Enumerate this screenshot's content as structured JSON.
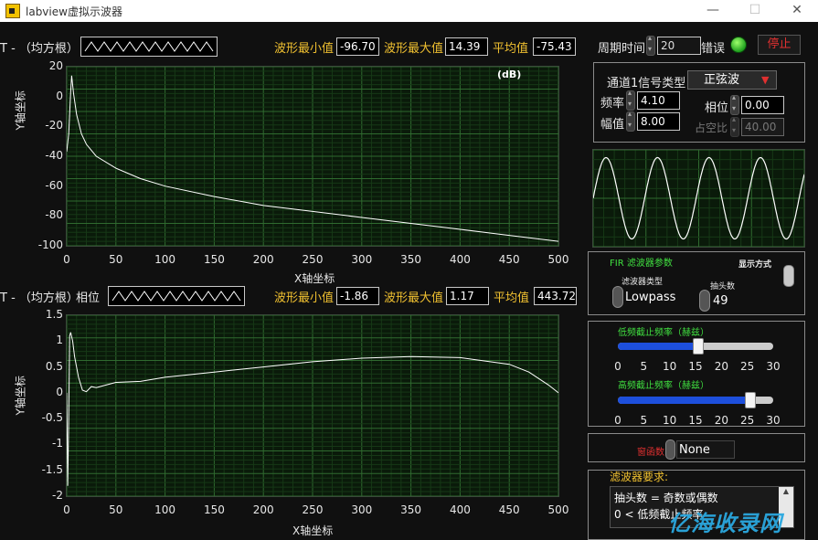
{
  "window": {
    "title": "labview虚拟示波器"
  },
  "graph1": {
    "header_prefix": "T - （均方根）",
    "min_label": "波形最小值",
    "min_value": "-96.70",
    "max_label": "波形最大值",
    "max_value": "14.39",
    "avg_label": "平均值",
    "avg_value": "-75.43",
    "unit_tag": "(dB)",
    "y_label": "Y轴坐标",
    "x_label": "X轴坐标",
    "y_ticks": [
      "20",
      "0",
      "-20",
      "-40",
      "-60",
      "-80",
      "-100"
    ],
    "x_ticks": [
      "0",
      "50",
      "100",
      "150",
      "200",
      "250",
      "300",
      "350",
      "400",
      "450",
      "500"
    ]
  },
  "graph2": {
    "header_prefix": "T - （均方根）",
    "phase_label": "相位",
    "min_label": "波形最小值",
    "min_value": "-1.86",
    "max_label": "波形最大值",
    "max_value": "1.17",
    "avg_label": "平均值",
    "avg_value": "443.72n",
    "y_label": "Y轴坐标",
    "x_label": "X轴坐标",
    "y_ticks": [
      "1.5",
      "1",
      "0.5",
      "0",
      "-0.5",
      "-1",
      "-1.5",
      "-2"
    ],
    "x_ticks": [
      "0",
      "50",
      "100",
      "150",
      "200",
      "250",
      "300",
      "350",
      "400",
      "450",
      "500"
    ]
  },
  "controls": {
    "period_label": "周期时间",
    "period_value": "20",
    "error_label": "错误",
    "stop_label": "停止",
    "signal_type_label": "通道1信号类型",
    "signal_type_value": "正弦波",
    "freq_label": "频率",
    "freq_value": "4.10",
    "amp_label": "幅值",
    "amp_value": "8.00",
    "phase_label": "相位",
    "phase_value": "0.00",
    "duty_label": "占空比",
    "duty_value": "40.00"
  },
  "fir": {
    "title": "FIR 滤波器参数",
    "type_label": "滤波器类型",
    "type_value": "Lowpass",
    "taps_label": "抽头数",
    "taps_value": "49",
    "display_label": "显示方式"
  },
  "sliders": {
    "low_label": "低频截止频率（赫兹）",
    "low_value": 15.5,
    "high_label": "高频截止频率（赫兹）",
    "high_value": 25.5,
    "ticks": [
      "0",
      "5",
      "10",
      "15",
      "20",
      "25",
      "30"
    ],
    "max": 30
  },
  "window_fn": {
    "label": "窗函数",
    "value": "None"
  },
  "requirements": {
    "title": "滤波器要求:",
    "line1": "抽头数 = 奇数或偶数",
    "line2": "0 < 低频截止频率"
  },
  "watermark": "亿海收录网",
  "chart_data": [
    {
      "type": "line",
      "title": "(dB)",
      "xlabel": "X轴坐标",
      "ylabel": "Y轴坐标",
      "xlim": [
        0,
        500
      ],
      "ylim": [
        -100,
        20
      ],
      "grid": true,
      "x": [
        0,
        2,
        4,
        5,
        7,
        10,
        15,
        20,
        30,
        50,
        75,
        100,
        150,
        200,
        250,
        300,
        350,
        400,
        450,
        500
      ],
      "y": [
        -37,
        -25,
        3,
        14,
        2,
        -12,
        -25,
        -32,
        -40,
        -48,
        -55,
        -60,
        -67,
        -73,
        -77,
        -81,
        -85,
        -89,
        -93,
        -97
      ]
    },
    {
      "type": "line",
      "xlabel": "X轴坐标",
      "ylabel": "Y轴坐标",
      "xlim": [
        0,
        500
      ],
      "ylim": [
        -2,
        1.5
      ],
      "grid": true,
      "x": [
        0,
        1,
        2,
        3,
        4,
        6,
        8,
        12,
        16,
        20,
        25,
        30,
        40,
        50,
        75,
        100,
        150,
        200,
        250,
        300,
        350,
        400,
        450,
        470,
        490,
        500
      ],
      "y": [
        0,
        -1.8,
        -0.5,
        1.1,
        1.17,
        1.0,
        0.7,
        0.3,
        0.05,
        0.02,
        0.12,
        0.1,
        0.15,
        0.2,
        0.22,
        0.3,
        0.4,
        0.5,
        0.6,
        0.67,
        0.7,
        0.68,
        0.55,
        0.4,
        0.15,
        0.0
      ]
    }
  ]
}
